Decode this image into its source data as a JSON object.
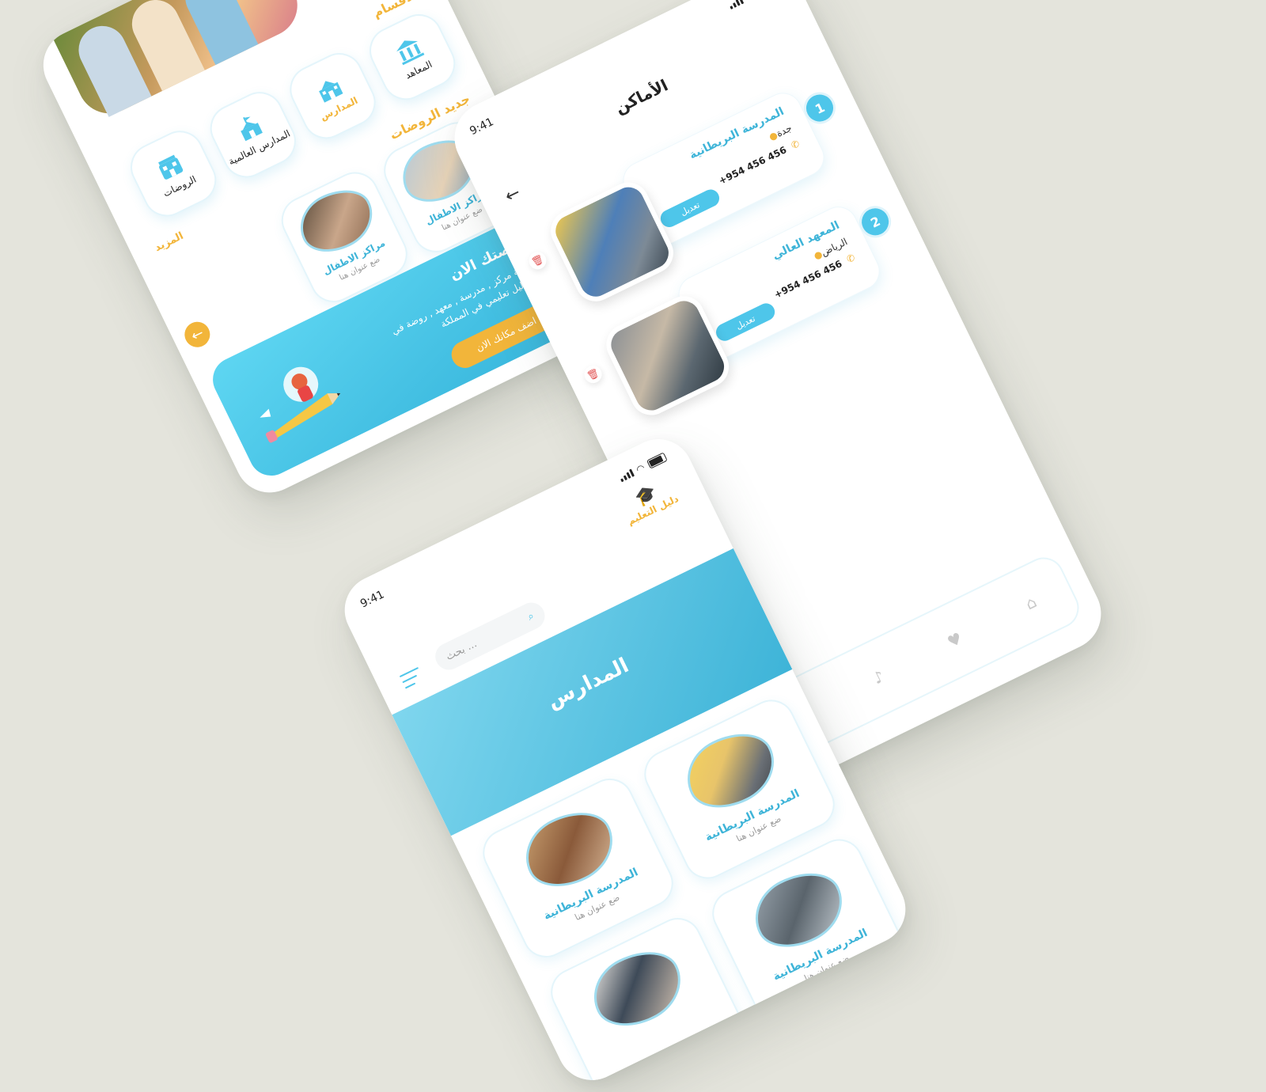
{
  "colors": {
    "background": "#e4e4dc",
    "accent_blue": "#4ec6ea",
    "accent_yellow": "#f2b53a",
    "text_dark": "#222222"
  },
  "home_screen": {
    "categories_title": "الأقسام",
    "categories": [
      {
        "label": "المعاهد",
        "icon": "institute-icon"
      },
      {
        "label": "المدارس",
        "icon": "school-icon",
        "active": true
      },
      {
        "label": "المدارس العالمية",
        "icon": "international-school-icon"
      },
      {
        "label": "الروضات",
        "icon": "kindergarten-icon"
      }
    ],
    "new_kindergartens_title": "جديد الروضات",
    "more_label": "المزيد",
    "kid_cards": [
      {
        "title": "مراكز الاطفال",
        "subtitle": "ضع عنوان هنا"
      },
      {
        "title": "مراكز الاطفال",
        "subtitle": "ضع عنوان هنا"
      }
    ],
    "promo": {
      "title": "فرصتك الان",
      "body": "لإضافة مركز , مدرسة , معهد , روضة في اكبر دليل تعليمي في المملكة",
      "button": "اضف مكانك الان"
    }
  },
  "places_screen": {
    "status_time": "9:41",
    "title": "الأماكن",
    "places": [
      {
        "number": "1",
        "name": "المدرسة البريطانية",
        "city": "جدة",
        "phone": "+954 456 456",
        "edit": "تعديل"
      },
      {
        "number": "2",
        "name": "المعهد العالي",
        "city": "الرياض",
        "phone": "+954 456 456",
        "edit": "تعديل"
      }
    ],
    "tabs": [
      "home-icon",
      "heart-icon",
      "bell-icon",
      "user-icon"
    ]
  },
  "schools_screen": {
    "status_time": "9:41",
    "logo_text": "دليل التعليم",
    "search_placeholder": "بحث ...",
    "banner_title": "المدارس",
    "schools": [
      {
        "title": "المدرسة البريطانية",
        "subtitle": "ضع عنوان هنا"
      },
      {
        "title": "المدرسة البريطانية",
        "subtitle": "ضع عنوان هنا"
      },
      {
        "title": "المدرسة البريطانية",
        "subtitle": "ضع عنوان هنا"
      },
      {
        "title": "",
        "subtitle": ""
      }
    ]
  }
}
